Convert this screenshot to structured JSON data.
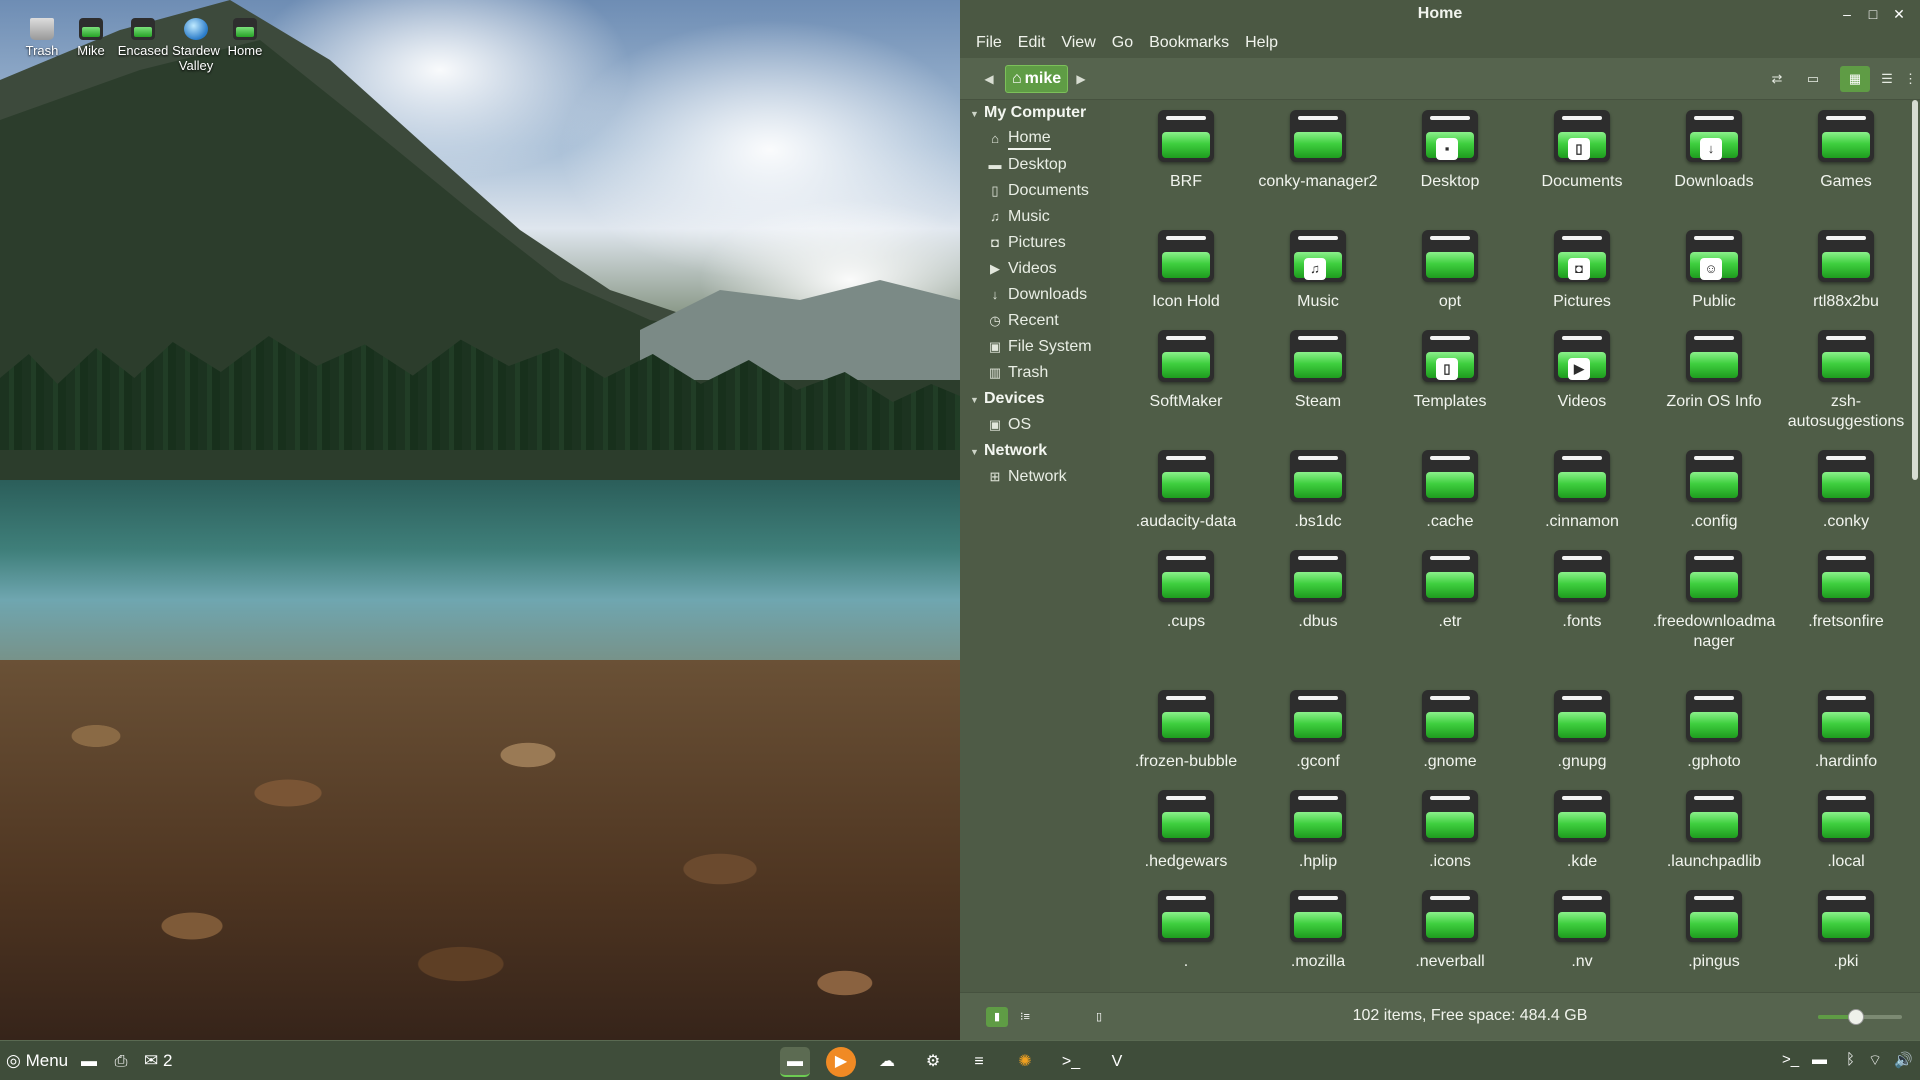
{
  "desktop": {
    "icons": [
      {
        "label": "Trash"
      },
      {
        "label": "Mike"
      },
      {
        "label": "Encased"
      },
      {
        "label": "Stardew Valley"
      },
      {
        "label": "Home"
      }
    ]
  },
  "window": {
    "title": "Home",
    "controls": {
      "minimize": "–",
      "maximize": "□",
      "close": "✕"
    }
  },
  "menu": [
    "File",
    "Edit",
    "View",
    "Go",
    "Bookmarks",
    "Help"
  ],
  "toolbar": {
    "back": "◀",
    "forward": "▶",
    "location": "mike"
  },
  "sidebar": {
    "sections": [
      {
        "title": "My Computer",
        "items": [
          {
            "label": "Home",
            "icon": "home-icon",
            "glyph": "⌂",
            "selected": true
          },
          {
            "label": "Desktop",
            "icon": "desktop-icon",
            "glyph": "▬"
          },
          {
            "label": "Documents",
            "icon": "document-icon",
            "glyph": "▯"
          },
          {
            "label": "Music",
            "icon": "music-icon",
            "glyph": "♫"
          },
          {
            "label": "Pictures",
            "icon": "camera-icon",
            "glyph": "◘"
          },
          {
            "label": "Videos",
            "icon": "video-icon",
            "glyph": "▶"
          },
          {
            "label": "Downloads",
            "icon": "download-icon",
            "glyph": "↓"
          },
          {
            "label": "Recent",
            "icon": "clock-icon",
            "glyph": "◷"
          },
          {
            "label": "File System",
            "icon": "drive-icon",
            "glyph": "▣"
          },
          {
            "label": "Trash",
            "icon": "trash-icon",
            "glyph": "▥"
          }
        ]
      },
      {
        "title": "Devices",
        "items": [
          {
            "label": "OS",
            "icon": "drive-icon",
            "glyph": "▣"
          }
        ]
      },
      {
        "title": "Network",
        "items": [
          {
            "label": "Network",
            "icon": "network-icon",
            "glyph": "⊞"
          }
        ]
      }
    ]
  },
  "files": [
    {
      "name": "BRF",
      "emblem": ""
    },
    {
      "name": "conky-manager2",
      "emblem": ""
    },
    {
      "name": "Desktop",
      "emblem": "desktop"
    },
    {
      "name": "Documents",
      "emblem": "▯"
    },
    {
      "name": "Downloads",
      "emblem": "↓"
    },
    {
      "name": "Games",
      "emblem": ""
    },
    {
      "name": "Icon Hold",
      "emblem": ""
    },
    {
      "name": "Music",
      "emblem": "♫"
    },
    {
      "name": "opt",
      "emblem": ""
    },
    {
      "name": "Pictures",
      "emblem": "◘"
    },
    {
      "name": "Public",
      "emblem": "☺"
    },
    {
      "name": "rtl88x2bu",
      "emblem": ""
    },
    {
      "name": "SoftMaker",
      "emblem": ""
    },
    {
      "name": "Steam",
      "emblem": ""
    },
    {
      "name": "Templates",
      "emblem": "▯"
    },
    {
      "name": "Videos",
      "emblem": "▶"
    },
    {
      "name": "Zorin OS Info",
      "emblem": ""
    },
    {
      "name": "zsh-autosuggestions",
      "emblem": ""
    },
    {
      "name": ".audacity-data",
      "emblem": ""
    },
    {
      "name": ".bs1dc",
      "emblem": ""
    },
    {
      "name": ".cache",
      "emblem": ""
    },
    {
      "name": ".cinnamon",
      "emblem": ""
    },
    {
      "name": ".config",
      "emblem": ""
    },
    {
      "name": ".conky",
      "emblem": ""
    },
    {
      "name": ".cups",
      "emblem": ""
    },
    {
      "name": ".dbus",
      "emblem": ""
    },
    {
      "name": ".etr",
      "emblem": ""
    },
    {
      "name": ".fonts",
      "emblem": ""
    },
    {
      "name": ".freedownloadmanager",
      "emblem": ""
    },
    {
      "name": ".fretsonfire",
      "emblem": ""
    },
    {
      "name": ".frozen-bubble",
      "emblem": ""
    },
    {
      "name": ".gconf",
      "emblem": ""
    },
    {
      "name": ".gnome",
      "emblem": ""
    },
    {
      "name": ".gnupg",
      "emblem": ""
    },
    {
      "name": ".gphoto",
      "emblem": ""
    },
    {
      "name": ".hardinfo",
      "emblem": ""
    },
    {
      "name": ".hedgewars",
      "emblem": ""
    },
    {
      "name": ".hplip",
      "emblem": ""
    },
    {
      "name": ".icons",
      "emblem": ""
    },
    {
      "name": ".kde",
      "emblem": ""
    },
    {
      "name": ".launchpadlib",
      "emblem": ""
    },
    {
      "name": ".local",
      "emblem": ""
    },
    {
      "name": ".",
      "emblem": ""
    },
    {
      "name": ".mozilla",
      "emblem": ""
    },
    {
      "name": ".neverball",
      "emblem": ""
    },
    {
      "name": ".nv",
      "emblem": ""
    },
    {
      "name": ".pingus",
      "emblem": ""
    },
    {
      "name": ".pki",
      "emblem": ""
    }
  ],
  "statusbar": {
    "text": "102 items, Free space: 484.4 GB",
    "zoom_level": 0.45
  },
  "taskbar": {
    "menu_label": "Menu",
    "notification_count": "2"
  },
  "colors": {
    "accent": "#5f9c45",
    "folder_green": "#3fcf3f",
    "window_bg": "#4f5d47"
  }
}
